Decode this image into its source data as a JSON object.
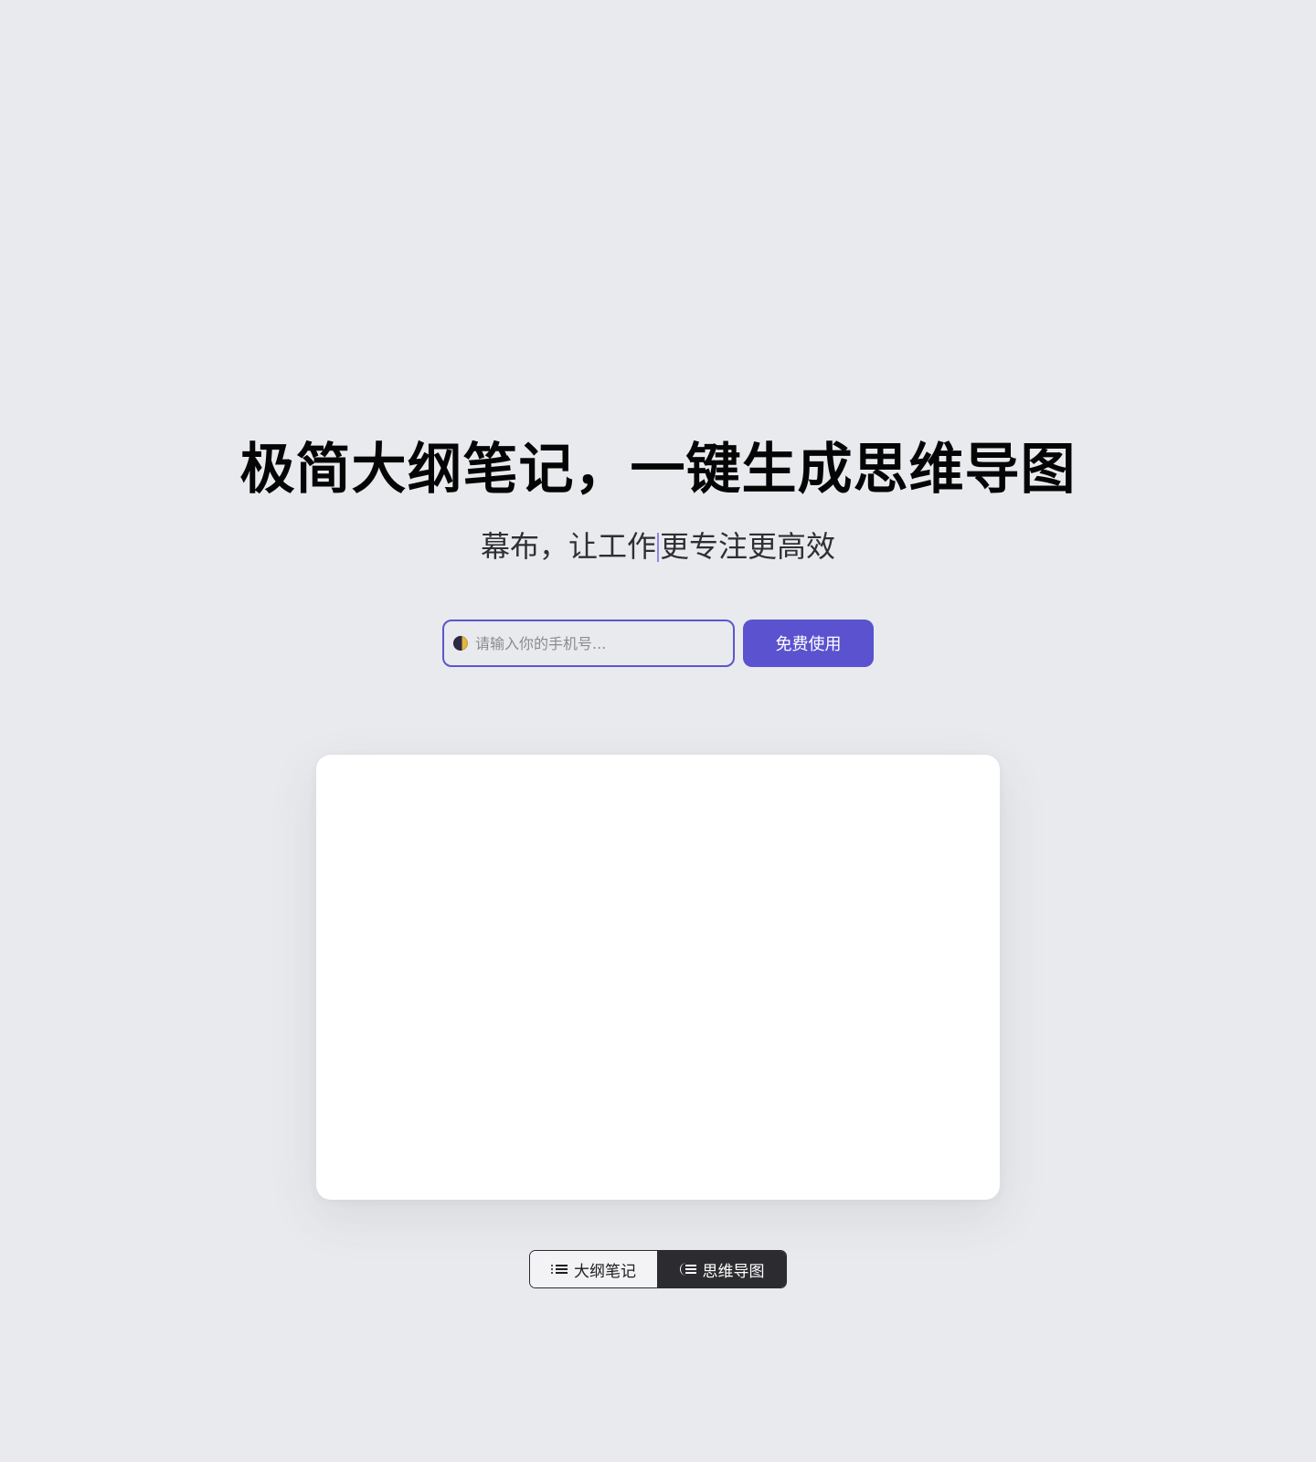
{
  "hero": {
    "title": "极简大纲笔记，一键生成思维导图",
    "subtitle_before_caret": "幕布，让工作",
    "subtitle_after_caret": "更专注更高效"
  },
  "signup": {
    "phone_placeholder": "请输入你的手机号...",
    "phone_value": "",
    "submit_label": "免费使用"
  },
  "mode_switch": {
    "outline_label": "大纲笔记",
    "mindmap_label": "思维导图",
    "selected": "思维导图"
  },
  "icons": {
    "field_icon": "moon-icon",
    "outline_icon": "list-icon",
    "mindmap_icon": "tree-icon"
  },
  "colors": {
    "page_background": "#e9eaed",
    "primary": "#5a52cf",
    "dark_tab": "#2c2c30",
    "card": "#ffffff"
  }
}
